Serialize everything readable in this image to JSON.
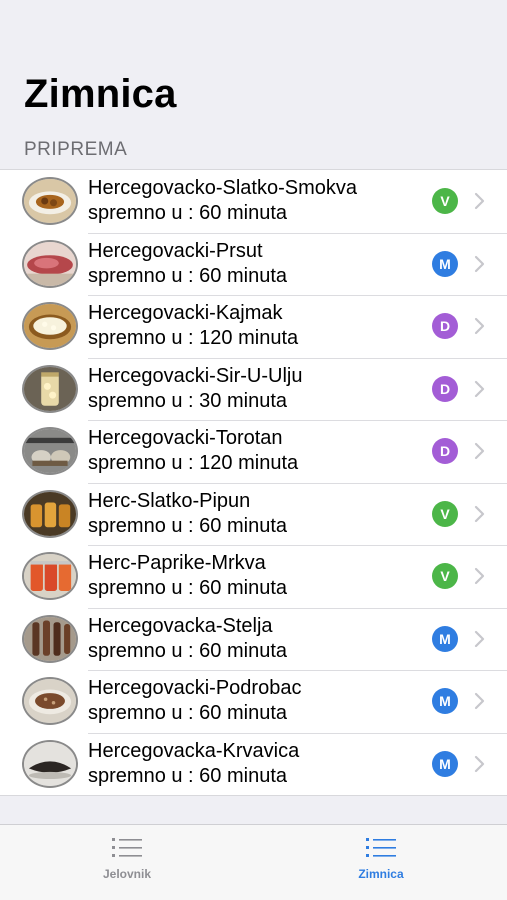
{
  "header": {
    "title": "Zimnica"
  },
  "section": {
    "title": "PRIPREMA"
  },
  "items": [
    {
      "title": "Hercegovacko-Slatko-Smokva",
      "subtitle": "spremno u : 60 minuta",
      "badge": "V",
      "badge_color": "#4cb648",
      "thumb": "dish-icon"
    },
    {
      "title": "Hercegovacki-Prsut",
      "subtitle": "spremno u : 60 minuta",
      "badge": "M",
      "badge_color": "#2f7de1",
      "thumb": "ham-icon"
    },
    {
      "title": "Hercegovacki-Kajmak",
      "subtitle": "spremno u : 120 minuta",
      "badge": "D",
      "badge_color": "#a35dd6",
      "thumb": "cream-icon"
    },
    {
      "title": "Hercegovacki-Sir-U-Ulju",
      "subtitle": "spremno u : 30 minuta",
      "badge": "D",
      "badge_color": "#a35dd6",
      "thumb": "jar-icon"
    },
    {
      "title": "Hercegovacki-Torotan",
      "subtitle": "spremno u : 120 minuta",
      "badge": "D",
      "badge_color": "#a35dd6",
      "thumb": "pots-icon"
    },
    {
      "title": "Herc-Slatko-Pipun",
      "subtitle": "spremno u : 60 minuta",
      "badge": "V",
      "badge_color": "#4cb648",
      "thumb": "jars-icon"
    },
    {
      "title": "Herc-Paprike-Mrkva",
      "subtitle": "spremno u : 60 minuta",
      "badge": "V",
      "badge_color": "#4cb648",
      "thumb": "pepper-jars-icon"
    },
    {
      "title": "Hercegovacka-Stelja",
      "subtitle": "spremno u : 60 minuta",
      "badge": "M",
      "badge_color": "#2f7de1",
      "thumb": "dried-meat-icon"
    },
    {
      "title": "Hercegovacki-Podrobac",
      "subtitle": "spremno u : 60 minuta",
      "badge": "M",
      "badge_color": "#2f7de1",
      "thumb": "meat-dish-icon"
    },
    {
      "title": "Hercegovacka-Krvavica",
      "subtitle": "spremno u : 60 minuta",
      "badge": "M",
      "badge_color": "#2f7de1",
      "thumb": "sausage-icon"
    }
  ],
  "tabs": [
    {
      "label": "Jelovnik",
      "active": false,
      "color": "#8e8e93"
    },
    {
      "label": "Zimnica",
      "active": true,
      "color": "#2f7de1"
    }
  ]
}
